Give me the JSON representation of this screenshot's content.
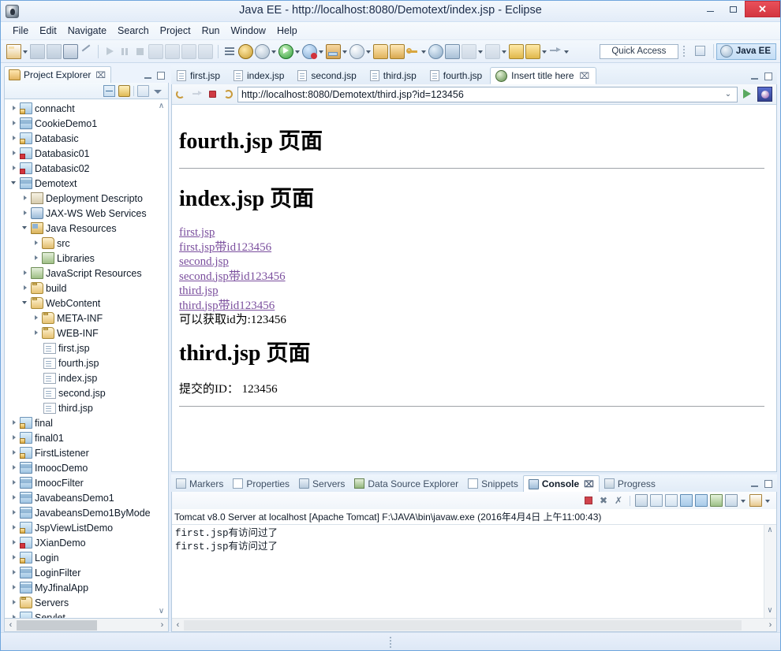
{
  "window": {
    "title": "Java EE - http://localhost:8080/Demotext/index.jsp - Eclipse",
    "app_icon": "eclipse-icon",
    "minimize_label": "",
    "maximize_label": "",
    "close_label": "✕"
  },
  "menubar": {
    "items": [
      "File",
      "Edit",
      "Navigate",
      "Search",
      "Project",
      "Run",
      "Window",
      "Help"
    ]
  },
  "toolbar": {
    "quick_access_placeholder": "Quick Access",
    "perspective_label": "Java EE",
    "icons": [
      "new-wizard-icon",
      "save-icon",
      "save-all-icon",
      "print-icon",
      "link-editor-icon",
      "run-icon",
      "pause-icon",
      "stop-icon",
      "step-into-icon",
      "step-over-icon",
      "step-return-icon",
      "drop-to-frame-icon",
      "toggle-breakpoint-icon",
      "debug-icon",
      "external-tools-icon",
      "run-as-icon",
      "debug-as-icon",
      "profile-icon",
      "coverage-icon",
      "open-type-icon",
      "new-folder-icon",
      "search-icon",
      "open-task-icon",
      "previous-annotation-icon",
      "next-annotation-icon",
      "back-icon",
      "forward-icon"
    ]
  },
  "project_explorer": {
    "view_title": "Project Explorer",
    "close_glyph": "⌧",
    "toolbar_icons": [
      "collapse-all-icon",
      "link-with-editor-icon",
      "view-filter-icon",
      "view-menu-icon"
    ],
    "tree": [
      {
        "label": "connacht",
        "indent": 0,
        "twisty": "collapsed",
        "icon": "web-project-icon"
      },
      {
        "label": "CookieDemo1",
        "indent": 0,
        "twisty": "collapsed",
        "icon": "dynamic-web-project-icon"
      },
      {
        "label": "Databasic",
        "indent": 0,
        "twisty": "collapsed",
        "icon": "web-project-icon"
      },
      {
        "label": "Databasic01",
        "indent": 0,
        "twisty": "collapsed",
        "icon": "web-project-error-icon"
      },
      {
        "label": "Databasic02",
        "indent": 0,
        "twisty": "collapsed",
        "icon": "web-project-error-icon"
      },
      {
        "label": "Demotext",
        "indent": 0,
        "twisty": "expanded",
        "icon": "dynamic-web-project-icon"
      },
      {
        "label": "Deployment Descripto",
        "indent": 1,
        "twisty": "collapsed",
        "icon": "deployment-descriptor-icon"
      },
      {
        "label": "JAX-WS Web Services",
        "indent": 1,
        "twisty": "collapsed",
        "icon": "web-services-icon"
      },
      {
        "label": "Java Resources",
        "indent": 1,
        "twisty": "expanded",
        "icon": "java-resources-icon"
      },
      {
        "label": "src",
        "indent": 2,
        "twisty": "collapsed",
        "icon": "source-folder-icon"
      },
      {
        "label": "Libraries",
        "indent": 2,
        "twisty": "collapsed",
        "icon": "libraries-icon"
      },
      {
        "label": "JavaScript Resources",
        "indent": 1,
        "twisty": "collapsed",
        "icon": "javascript-resources-icon"
      },
      {
        "label": "build",
        "indent": 1,
        "twisty": "collapsed",
        "icon": "folder-icon"
      },
      {
        "label": "WebContent",
        "indent": 1,
        "twisty": "expanded",
        "icon": "folder-icon"
      },
      {
        "label": "META-INF",
        "indent": 2,
        "twisty": "collapsed",
        "icon": "folder-icon"
      },
      {
        "label": "WEB-INF",
        "indent": 2,
        "twisty": "collapsed",
        "icon": "folder-icon"
      },
      {
        "label": "first.jsp",
        "indent": 2,
        "twisty": "none",
        "icon": "jsp-file-icon"
      },
      {
        "label": "fourth.jsp",
        "indent": 2,
        "twisty": "none",
        "icon": "jsp-file-icon"
      },
      {
        "label": "index.jsp",
        "indent": 2,
        "twisty": "none",
        "icon": "jsp-file-icon"
      },
      {
        "label": "second.jsp",
        "indent": 2,
        "twisty": "none",
        "icon": "jsp-file-icon"
      },
      {
        "label": "third.jsp",
        "indent": 2,
        "twisty": "none",
        "icon": "jsp-file-icon"
      },
      {
        "label": "final",
        "indent": 0,
        "twisty": "collapsed",
        "icon": "web-project-icon"
      },
      {
        "label": "final01",
        "indent": 0,
        "twisty": "collapsed",
        "icon": "web-project-icon"
      },
      {
        "label": "FirstListener",
        "indent": 0,
        "twisty": "collapsed",
        "icon": "web-project-icon"
      },
      {
        "label": "ImoocDemo",
        "indent": 0,
        "twisty": "collapsed",
        "icon": "dynamic-web-project-icon"
      },
      {
        "label": "ImoocFilter",
        "indent": 0,
        "twisty": "collapsed",
        "icon": "dynamic-web-project-icon"
      },
      {
        "label": "JavabeansDemo1",
        "indent": 0,
        "twisty": "collapsed",
        "icon": "dynamic-web-project-icon"
      },
      {
        "label": "JavabeansDemo1ByMode",
        "indent": 0,
        "twisty": "collapsed",
        "icon": "dynamic-web-project-icon"
      },
      {
        "label": "JspViewListDemo",
        "indent": 0,
        "twisty": "collapsed",
        "icon": "web-project-icon"
      },
      {
        "label": "JXianDemo",
        "indent": 0,
        "twisty": "collapsed",
        "icon": "web-project-error-icon"
      },
      {
        "label": "Login",
        "indent": 0,
        "twisty": "collapsed",
        "icon": "web-project-icon"
      },
      {
        "label": "LoginFilter",
        "indent": 0,
        "twisty": "collapsed",
        "icon": "dynamic-web-project-icon"
      },
      {
        "label": "MyJfinalApp",
        "indent": 0,
        "twisty": "collapsed",
        "icon": "dynamic-web-project-icon"
      },
      {
        "label": "Servers",
        "indent": 0,
        "twisty": "collapsed",
        "icon": "folder-icon"
      },
      {
        "label": "Servlet",
        "indent": 0,
        "twisty": "collapsed",
        "icon": "web-project-icon"
      }
    ],
    "scroll_up_glyph": "∧",
    "scroll_down_glyph": "∨",
    "hscroll_left_glyph": "‹",
    "hscroll_right_glyph": "›"
  },
  "editor": {
    "tabs": [
      {
        "label": "first.jsp",
        "icon": "jsp-file-icon",
        "active": false
      },
      {
        "label": "index.jsp",
        "icon": "jsp-file-icon",
        "active": false
      },
      {
        "label": "second.jsp",
        "icon": "jsp-file-icon",
        "active": false
      },
      {
        "label": "third.jsp",
        "icon": "jsp-file-icon",
        "active": false
      },
      {
        "label": "fourth.jsp",
        "icon": "jsp-file-icon",
        "active": false
      },
      {
        "label": "Insert title here",
        "icon": "web-browser-icon",
        "active": true,
        "close_glyph": "⌧"
      }
    ]
  },
  "browser": {
    "url": "http://localhost:8080/Demotext/third.jsp?id=123456",
    "nav_icons": [
      "back-icon",
      "forward-icon",
      "stop-icon",
      "refresh-icon"
    ],
    "dropdown_glyph": "⌄",
    "go_icon": "go-icon",
    "open-external-icon": "open-external-browser-icon",
    "page": {
      "heading1": "fourth.jsp 页面",
      "heading2": "index.jsp 页面",
      "links": [
        "first.jsp",
        "first.jsp带id123456",
        "second.jsp",
        "second.jsp带id123456",
        "third.jsp",
        "third.jsp带id123456"
      ],
      "plain_line": "可以获取id为:123456",
      "heading3": "third.jsp 页面",
      "submitted_id_line": "提交的ID： 123456"
    }
  },
  "bottom_panel": {
    "tabs": [
      {
        "label": "Markers",
        "icon": "markers-icon",
        "active": false
      },
      {
        "label": "Properties",
        "icon": "properties-icon",
        "active": false
      },
      {
        "label": "Servers",
        "icon": "servers-icon",
        "active": false
      },
      {
        "label": "Data Source Explorer",
        "icon": "data-source-explorer-icon",
        "active": false
      },
      {
        "label": "Snippets",
        "icon": "snippets-icon",
        "active": false
      },
      {
        "label": "Console",
        "icon": "console-icon",
        "active": true,
        "close_glyph": "⌧"
      },
      {
        "label": "Progress",
        "icon": "progress-icon",
        "active": false
      }
    ],
    "console_toolbar_icons": [
      "terminate-icon",
      "remove-launch-icon",
      "remove-all-launches-icon",
      "clear-console-icon",
      "scroll-lock-icon",
      "word-wrap-icon",
      "show-console-on-output-icon",
      "show-console-on-error-icon",
      "pin-console-icon",
      "display-selected-console-icon",
      "display-selected-console-arrow",
      "open-console-icon",
      "open-console-arrow"
    ],
    "console_header": "Tomcat v8.0 Server at localhost [Apache Tomcat] F:\\JAVA\\bin\\javaw.exe (2016年4月4日 上午11:00:43)",
    "console_lines": [
      "first.jsp有访问过了",
      "first.jsp有访问过了"
    ],
    "scroll_up_glyph": "∧",
    "scroll_down_glyph": "∨",
    "hscroll_left_glyph": "‹",
    "hscroll_right_glyph": "›"
  },
  "colors": {
    "window_border": "#6fa6dd",
    "close_button": "#d33640",
    "link": "#7b4f9e",
    "active_tab_bg": "#ffffff",
    "panel_border": "#b6cbdf"
  }
}
